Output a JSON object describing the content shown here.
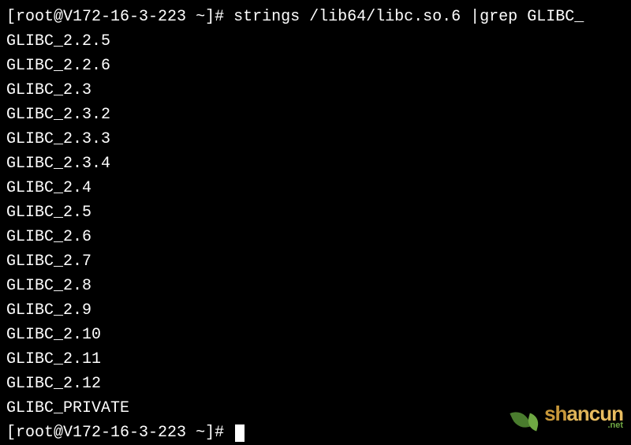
{
  "prompt1": {
    "open": "[",
    "user": "root@V172-16-3-223",
    "space": " ",
    "tilde": "~",
    "close": "]",
    "hash": "#",
    "command": " strings /lib64/libc.so.6 |grep GLIBC_"
  },
  "output_lines": [
    "GLIBC_2.2.5",
    "GLIBC_2.2.6",
    "GLIBC_2.3",
    "GLIBC_2.3.2",
    "GLIBC_2.3.3",
    "GLIBC_2.3.4",
    "GLIBC_2.4",
    "GLIBC_2.5",
    "GLIBC_2.6",
    "GLIBC_2.7",
    "GLIBC_2.8",
    "GLIBC_2.9",
    "GLIBC_2.10",
    "GLIBC_2.11",
    "GLIBC_2.12",
    "GLIBC_PRIVATE"
  ],
  "prompt2": {
    "open": "[",
    "user": "root@V172-16-3-223",
    "space": " ",
    "tilde": "~",
    "close": "]",
    "hash": "#",
    "command": " "
  },
  "watermark": {
    "sh": "sh",
    "an": "an",
    "cun": "cun",
    "sub": ".net"
  }
}
